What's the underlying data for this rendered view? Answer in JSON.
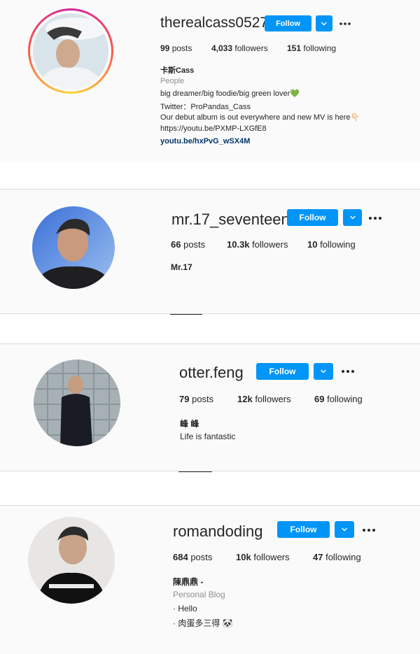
{
  "colors": {
    "accent": "#0095f6",
    "link": "#00376b",
    "muted": "#8e8e8e"
  },
  "follow_label": "Follow",
  "profiles": [
    {
      "username": "therealcass0527",
      "posts_count": "99",
      "posts_label": "posts",
      "followers_count": "4,033",
      "followers_label": "followers",
      "following_count": "151",
      "following_label": "following",
      "full_name": "卡斯Cass",
      "category": "People",
      "bio_lines": [
        "big dreamer/big foodie/big green lover💚",
        "Twitter：ProPandas_Cass",
        "Our debut album is out everywhere and new MV is here👇🏻",
        "https://youtu.be/PXMP-LXGfE8"
      ],
      "website": "youtu.be/hxPvG_wSX4M",
      "story_ring": true
    },
    {
      "username": "mr.17_seventeen",
      "posts_count": "66",
      "posts_label": "posts",
      "followers_count": "10.3k",
      "followers_label": "followers",
      "following_count": "10",
      "following_label": "following",
      "full_name": "Mr.17"
    },
    {
      "username": "otter.feng",
      "posts_count": "79",
      "posts_label": "posts",
      "followers_count": "12k",
      "followers_label": "followers",
      "following_count": "69",
      "following_label": "following",
      "full_name": "峰 峰",
      "bio_lines": [
        "Life is fantastic"
      ]
    },
    {
      "username": "romandoding",
      "posts_count": "684",
      "posts_label": "posts",
      "followers_count": "10k",
      "followers_label": "followers",
      "following_count": "47",
      "following_label": "following",
      "full_name": "陳鼎鼎 -",
      "category": "Personal Blog",
      "bio_lines": [
        "· Hello",
        "· 肉蛋多三得 🐼"
      ]
    }
  ]
}
